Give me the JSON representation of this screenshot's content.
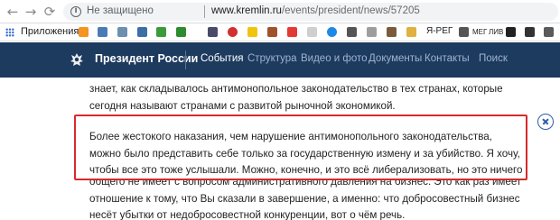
{
  "browser": {
    "security_label": "Не защищено",
    "url_host": "www.kremlin.ru",
    "url_path": "/events/president/news/57205",
    "bookmarks_apps_label": "Приложения",
    "bookmark_text_1": "Я-РЕГ",
    "bookmark_text_2": "МЕГ",
    "bookmark_text_3": "ЛИВ",
    "bookmark_icons": [
      "ok-icon",
      "image-icon",
      "image-icon",
      "image-icon",
      "leaf-icon",
      "leaf-icon",
      "opera-icon",
      "image-icon",
      "image-icon",
      "yandex-icon",
      "image-icon",
      "image-icon",
      "image-icon",
      "dark-site-icon",
      "music-icon",
      "s-letter-icon",
      "grid-icon"
    ]
  },
  "site_nav": {
    "brand": "Президент России",
    "items": [
      {
        "label": "События",
        "active": true
      },
      {
        "label": "Структура",
        "active": false
      },
      {
        "label": "Видео и фото",
        "active": false
      },
      {
        "label": "Документы",
        "active": false
      },
      {
        "label": "Контакты",
        "active": false
      },
      {
        "label": "Поиск",
        "active": false
      }
    ]
  },
  "article": {
    "para1": [
      "знает, как складывалось антимонопольное законодательство в тех странах, которые",
      "сегодня называют странами с развитой рыночной экономикой."
    ],
    "para2": [
      "Более жестокого наказания, чем нарушение антимонопольного законодательства,",
      "можно было представить себе только за государственную измену и за убийство. Я хочу,",
      "чтобы все это тоже услышали. Можно, конечно, и это всё либерализовать, но это ничего"
    ],
    "para3": [
      "общего не имеет с вопросом административного давления на бизнес. Это как раз имеет",
      "отношение к тому, что Вы сказали в завершение, а именно: что добросовестный бизнес",
      "несёт убытки от недобросовестной конкуренции, вот о чём речь."
    ]
  },
  "colors": {
    "nav_background": "#1d3a5f",
    "highlight_border": "#d62b2b",
    "close_button": "#2f5fa8"
  }
}
